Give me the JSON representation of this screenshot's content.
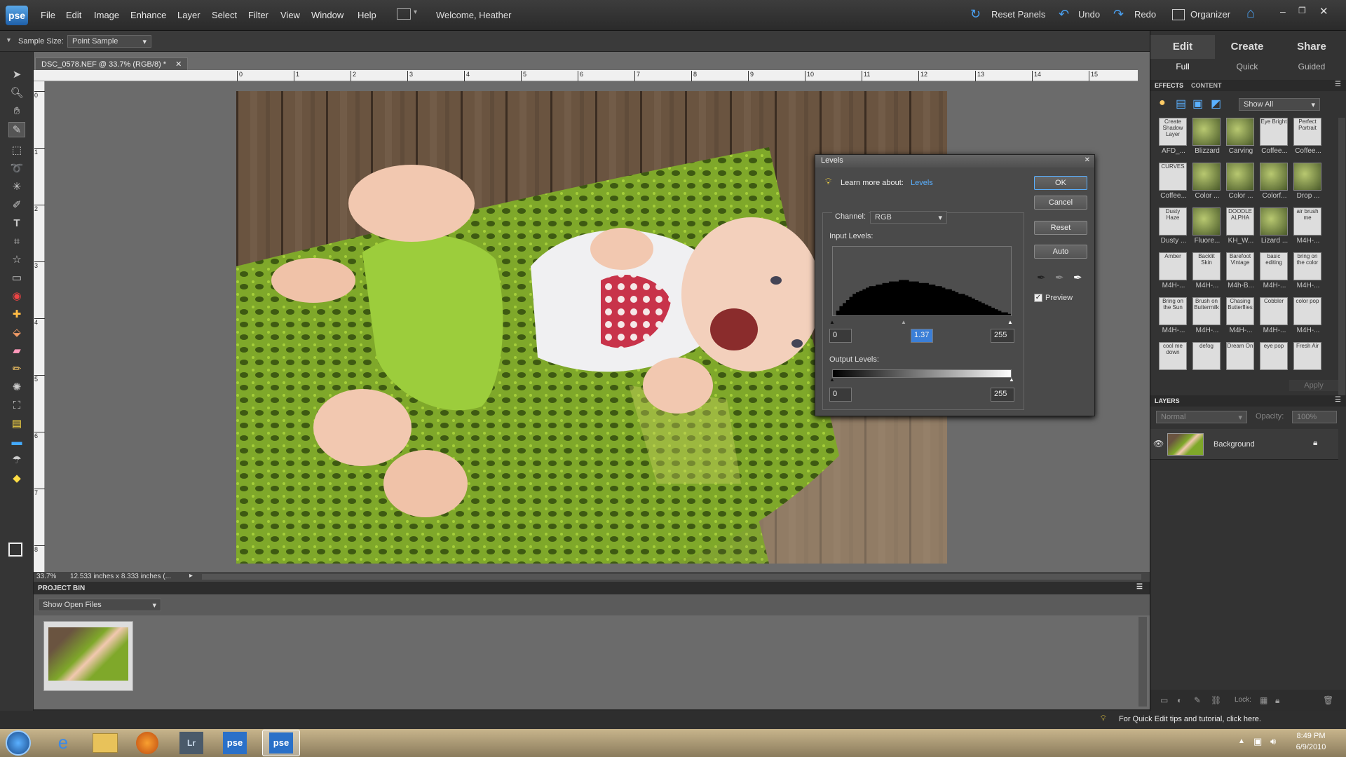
{
  "app": {
    "logo": "pse",
    "welcome": "Welcome, Heather"
  },
  "menu": [
    "File",
    "Edit",
    "Image",
    "Enhance",
    "Layer",
    "Select",
    "Filter",
    "View",
    "Window",
    "Help"
  ],
  "topbar": {
    "reset_panels": "Reset Panels",
    "undo": "Undo",
    "redo": "Redo",
    "organizer": "Organizer"
  },
  "options": {
    "sample_size_label": "Sample Size:",
    "sample_size_value": "Point Sample"
  },
  "document": {
    "tab_title": "DSC_0578.NEF @ 33.7% (RGB/8) *",
    "zoom": "33.7%",
    "dimensions": "12.533 inches x 8.333 inches (..."
  },
  "ruler": {
    "h_ticks": [
      "0",
      "1",
      "2",
      "3",
      "4",
      "5",
      "6",
      "7",
      "8",
      "9",
      "10",
      "11",
      "12",
      "13",
      "14",
      "15"
    ],
    "v_ticks": [
      "0",
      "1",
      "2",
      "3",
      "4",
      "5",
      "6",
      "7",
      "8"
    ]
  },
  "project_bin": {
    "title": "PROJECT BIN",
    "filter": "Show Open Files"
  },
  "panel": {
    "tabs": [
      "Edit",
      "Create",
      "Share"
    ],
    "subtabs": [
      "Full",
      "Quick",
      "Guided"
    ],
    "effects_tabs": [
      "EFFECTS",
      "CONTENT"
    ],
    "effects_filter": "Show All",
    "effects": [
      {
        "label": "AFD_...",
        "thumb": "Create Shadow Layer"
      },
      {
        "label": "Blizzard",
        "thumb": ""
      },
      {
        "label": "Carving",
        "thumb": ""
      },
      {
        "label": "Coffee...",
        "thumb": "Eye Bright"
      },
      {
        "label": "Coffee...",
        "thumb": "Perfect Portrait"
      },
      {
        "label": "Coffee...",
        "thumb": "CURVES"
      },
      {
        "label": "Color ...",
        "thumb": ""
      },
      {
        "label": "Color ...",
        "thumb": ""
      },
      {
        "label": "Colorf...",
        "thumb": ""
      },
      {
        "label": "Drop ...",
        "thumb": ""
      },
      {
        "label": "Dusty ...",
        "thumb": "Dusty Haze"
      },
      {
        "label": "Fluore...",
        "thumb": ""
      },
      {
        "label": "KH_W...",
        "thumb": "DOODLE ALPHA"
      },
      {
        "label": "Lizard ...",
        "thumb": ""
      },
      {
        "label": "M4H-...",
        "thumb": "air brush me"
      },
      {
        "label": "M4H-...",
        "thumb": "Amber"
      },
      {
        "label": "M4H-...",
        "thumb": "Backlit Skin"
      },
      {
        "label": "M4h-B...",
        "thumb": "Barefoot Vintage"
      },
      {
        "label": "M4H-...",
        "thumb": "basic editing"
      },
      {
        "label": "M4H-...",
        "thumb": "bring on the color"
      },
      {
        "label": "M4H-...",
        "thumb": "Bring on the Sun"
      },
      {
        "label": "M4H-...",
        "thumb": "Brush on Buttermilk"
      },
      {
        "label": "M4H-...",
        "thumb": "Chasing Butterflies"
      },
      {
        "label": "M4H-...",
        "thumb": "Cobbler"
      },
      {
        "label": "M4H-...",
        "thumb": "color pop"
      },
      {
        "label": "",
        "thumb": "cool me down"
      },
      {
        "label": "",
        "thumb": "defog"
      },
      {
        "label": "",
        "thumb": "Dream On"
      },
      {
        "label": "",
        "thumb": "eye pop"
      },
      {
        "label": "",
        "thumb": "Fresh Air"
      }
    ],
    "apply": "Apply",
    "layers_title": "LAYERS",
    "blend_mode": "Normal",
    "opacity_label": "Opacity:",
    "opacity_value": "100%",
    "layer_name": "Background",
    "lock_label": "Lock:"
  },
  "levels": {
    "title": "Levels",
    "learn_more": "Learn more about:",
    "learn_link": "Levels",
    "channel_label": "Channel:",
    "channel": "RGB",
    "input_label": "Input Levels:",
    "input_black": "0",
    "input_gamma": "1.37",
    "input_white": "255",
    "output_label": "Output Levels:",
    "output_black": "0",
    "output_white": "255",
    "buttons": {
      "ok": "OK",
      "cancel": "Cancel",
      "reset": "Reset",
      "auto": "Auto"
    },
    "preview": "Preview",
    "histogram": [
      0,
      3,
      6,
      8,
      10,
      12,
      14,
      15,
      16,
      17,
      18,
      19,
      19,
      20,
      20,
      21,
      21,
      22,
      22,
      22,
      23,
      23,
      23,
      22,
      22,
      22,
      21,
      21,
      21,
      20,
      20,
      19,
      19,
      18,
      17,
      17,
      16,
      15,
      14,
      14,
      13,
      12,
      11,
      10,
      9,
      8,
      7,
      6,
      5,
      4,
      3,
      2,
      2,
      1
    ]
  },
  "hint": "For Quick Edit tips and tutorial, click here.",
  "clock": {
    "time": "8:49 PM",
    "date": "6/9/2010"
  },
  "taskbar": {
    "apps": [
      "Internet Explorer",
      "Explorer",
      "Firefox",
      "Lr",
      "pse",
      "pse"
    ]
  },
  "colors": {
    "accent": "#3b7fd8",
    "blanket": "#7fa82a",
    "floor": "#6e5a44"
  }
}
